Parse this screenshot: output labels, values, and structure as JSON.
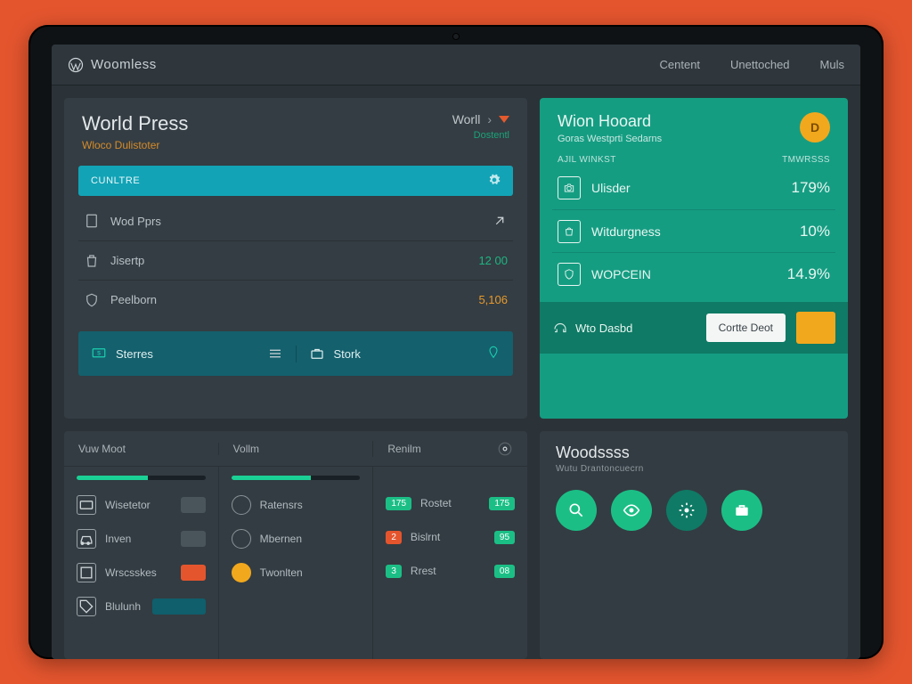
{
  "topbar": {
    "brand": "Woomless",
    "nav": {
      "a": "Centent",
      "b": "Unettoched",
      "c": "Muls"
    }
  },
  "left_top": {
    "title": "World Press",
    "subtitle": "Wloco Dulistoter",
    "selector_label": "Worll",
    "selector_sub": "Dostentl",
    "tab_label": "CUNLTRE",
    "rows": [
      {
        "label": "Wod Pprs",
        "value": "",
        "value_class": ""
      },
      {
        "label": "Jisertp",
        "value": "12 00",
        "value_class": "val-g"
      },
      {
        "label": "Peelborn",
        "value": "5,106",
        "value_class": "val-o"
      }
    ],
    "bottom": {
      "a": "Sterres",
      "b": "Stork"
    }
  },
  "right_top": {
    "title": "Wion Hooard",
    "subtitle": "Goras Westprti Sedarns",
    "badge": "D",
    "meta_left": "AJIL WINKST",
    "meta_right": "TMWRSSS",
    "rows": [
      {
        "label": "Ulisder",
        "pct": "179%"
      },
      {
        "label": "Witdurgness",
        "pct": "10%"
      },
      {
        "label": "WOPCEIN",
        "pct": "14.9%"
      }
    ],
    "footer_tag": "Wto Dasbd",
    "button": "Cortte Deot"
  },
  "left_bottom": {
    "cols": [
      {
        "head": "Vuw Moot",
        "progress": 55,
        "items": [
          {
            "label": "Wisetetor",
            "chip": ""
          },
          {
            "label": "Inven",
            "chip": ""
          },
          {
            "label": "Wrscsskes",
            "chip": "og"
          },
          {
            "label": "Blulunh",
            "chip": "db"
          }
        ]
      },
      {
        "head": "Vollm",
        "progress": 62,
        "items": [
          {
            "label": "Ratensrs",
            "chip": ""
          },
          {
            "label": "Mbernen",
            "chip": ""
          },
          {
            "label": "Twonlten",
            "chip": ""
          }
        ]
      },
      {
        "head": "Renilm",
        "progress": 0,
        "items": [
          {
            "label": "Rostet",
            "chipn": "175"
          },
          {
            "label": "Bislrnt",
            "chipn": "95"
          },
          {
            "label": "Rrest",
            "chipn": "08"
          }
        ]
      }
    ]
  },
  "right_bottom": {
    "title": "Woodssss",
    "subtitle": "Wutu Drantoncuecrn"
  },
  "colors": {
    "accent_orange": "#e4552e",
    "accent_teal": "#159d82",
    "accent_cyan": "#12a3b6",
    "accent_amber": "#f2a81d"
  }
}
